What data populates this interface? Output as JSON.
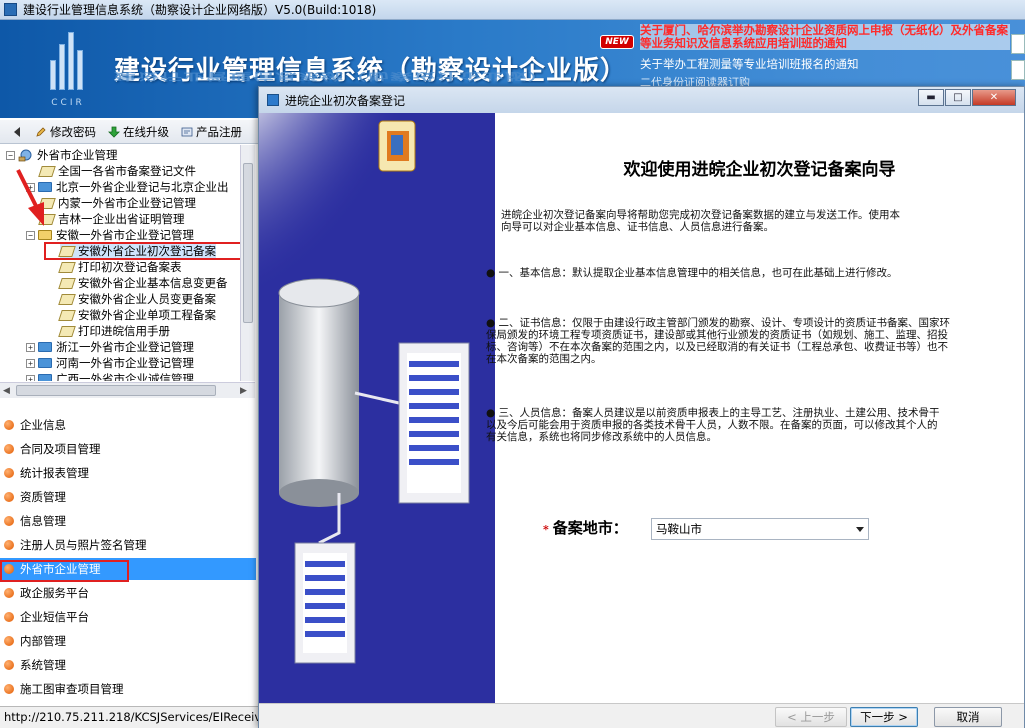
{
  "window": {
    "title": "建设行业管理信息系统（勘察设计企业网络版）V5.0(Build:1018)"
  },
  "banner": {
    "title": "建设行业管理信息系统（勘察设计企业版）",
    "logo_text": "CCIR",
    "news_badge": "NEW",
    "notices": [
      "关于厦门、哈尔滨举办勘察设计企业资质网上申报（无纸化）及外省备案等业务知识及信息系统应用培训班的通知",
      "关于举办工程测量等专业培训班报名的通知",
      "二代身份证阅读器订购"
    ]
  },
  "toolbar": {
    "change_password": "修改密码",
    "online_upgrade": "在线升级",
    "product_register": "产品注册"
  },
  "tree": {
    "root": "外省市企业管理",
    "items": [
      "全国一各省市备案登记文件",
      "北京一外省企业登记与北京企业出",
      "内蒙一外省市企业登记管理",
      "吉林一企业出省证明管理",
      "安徽一外省市企业登记管理",
      "安徽外省企业初次登记备案",
      "打印初次登记备案表",
      "安徽外省企业基本信息变更备",
      "安徽外省企业人员变更备案",
      "安徽外省企业单项工程备案",
      "打印进皖信用手册",
      "浙江一外省市企业登记管理",
      "河南一外省市企业登记管理",
      "广西一外省市企业诚信管理"
    ]
  },
  "menu": {
    "items": [
      "企业信息",
      "合同及项目管理",
      "统计报表管理",
      "资质管理",
      "信息管理",
      "注册人员与照片签名管理",
      "外省市企业管理",
      "政企服务平台",
      "企业短信平台",
      "内部管理",
      "系统管理",
      "施工图审查项目管理"
    ],
    "selected": "外省市企业管理"
  },
  "status": {
    "url": "http://210.75.211.218/KCSJServices/EIReceiver"
  },
  "dialog": {
    "title": "进皖企业初次备案登记",
    "minimize": "▬",
    "maximize": "□",
    "close": "✕",
    "heading": "欢迎使用进皖企业初次登记备案向导",
    "intro": "进皖企业初次登记备案向导将帮助您完成初次登记备案数据的建立与发送工作。使用本向导可以对企业基本信息、证书信息、人员信息进行备案。",
    "p1": "● 一、基本信息：默认提取企业基本信息管理中的相关信息，也可在此基础上进行修改。",
    "p2": "● 二、证书信息：仅限于由建设行政主管部门颁发的勘察、设计、专项设计的资质证书备案、国家环保局颁发的环境工程专项资质证书，建设部或其他行业颁发的资质证书（如规划、施工、监理、招投标、咨询等）不在本次备案的范围之内，以及已经取消的有关证书（工程总承包、收费证书等）也不在本次备案的范围之内。",
    "p3": "● 三、人员信息：备案人员建议是以前资质申报表上的主导工艺、注册执业、土建公用、技术骨干以及今后可能会用于资质申报的各类技术骨干人员，人数不限。在备案的页面，可以修改其个人的有关信息，系统也将同步修改系统中的人员信息。",
    "city_asterisk": "*",
    "city_label": "备案地市：",
    "city_value": "马鞍山市",
    "prev": "< 上一步",
    "next": "下一步 >",
    "cancel": "取消"
  }
}
